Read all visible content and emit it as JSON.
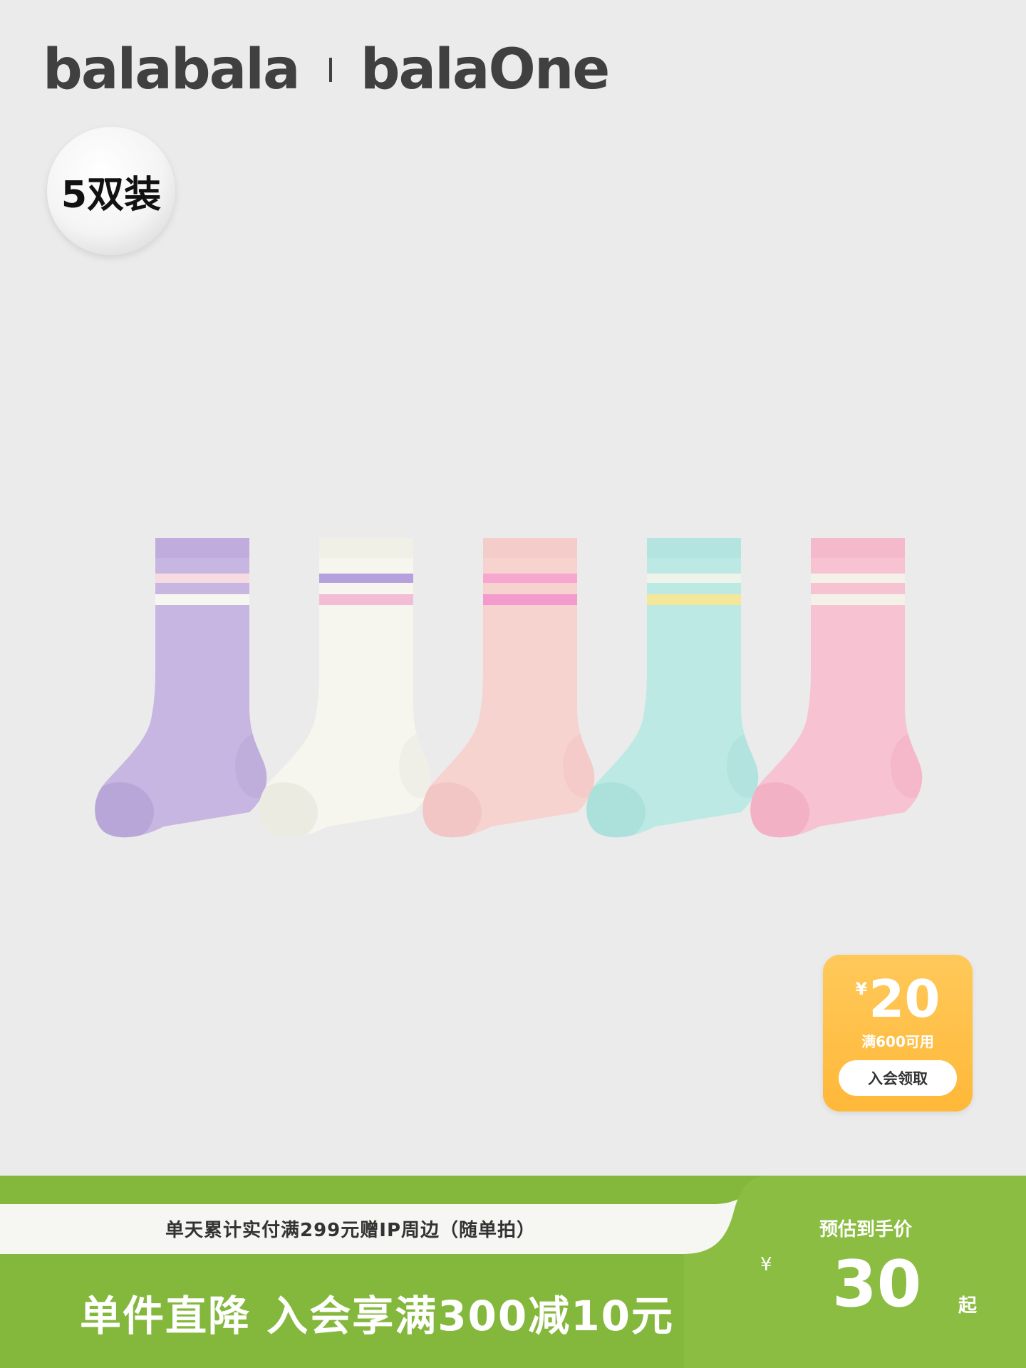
{
  "header": {
    "brand_primary": "balabala",
    "brand_secondary": "balaOne"
  },
  "pack_badge": "5双装",
  "product": {
    "socks": [
      {
        "body": "#c7b6e2",
        "stripe_a": "#f6dce0",
        "stripe_b": "#f7f7f2",
        "toe": "#b9a6d8"
      },
      {
        "body": "#f6f5ee",
        "stripe_a": "#b59fdd",
        "stripe_b": "#f4bdd6",
        "toe": "#ecebe2"
      },
      {
        "body": "#f7d3d0",
        "stripe_a": "#f6a6cf",
        "stripe_b": "#f49bcd",
        "toe": "#f2c6c4"
      },
      {
        "body": "#bde9e4",
        "stripe_a": "#eef4ea",
        "stripe_b": "#f4e79a",
        "toe": "#ace0da"
      },
      {
        "body": "#f7c3d3",
        "stripe_a": "#f4f1e8",
        "stripe_b": "#f4f1e8",
        "toe": "#f2b1c4"
      }
    ]
  },
  "coupon": {
    "currency": "¥",
    "amount": "20",
    "condition": "满600可用",
    "button_label": "入会领取"
  },
  "bottom_bar": {
    "info_text": "单天累计实付满299元赠IP周边（随单拍）",
    "promo_text": "单件直降  入会享满300减10元",
    "estimate_label": "预估到手价",
    "currency": "¥",
    "price": "30",
    "price_suffix": "起"
  },
  "colors": {
    "background": "#ebebeb",
    "brand_text": "#404040",
    "coupon_orange": "#ffbe45",
    "bar_green": "#84b83c",
    "info_strip": "#f6f6f2"
  }
}
